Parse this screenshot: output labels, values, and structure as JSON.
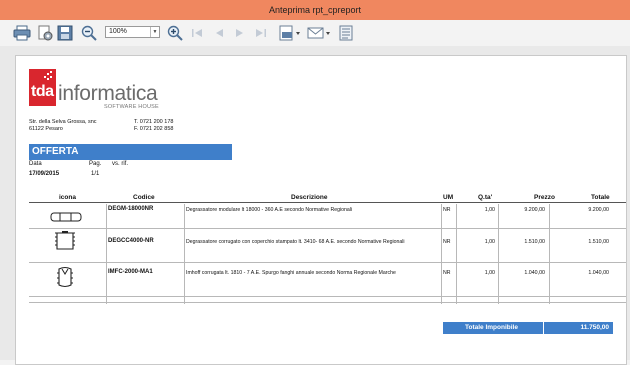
{
  "window": {
    "title": "Anteprima rpt_cpreport"
  },
  "toolbar": {
    "zoom": "100%",
    "icons": [
      "print-icon",
      "page-setup-icon",
      "save-icon",
      "zoom-out-icon",
      "zoom-in-icon",
      "first-page-icon",
      "previous-page-icon",
      "next-page-icon",
      "last-page-icon",
      "export-icon",
      "email-icon",
      "document-icon"
    ]
  },
  "company": {
    "logo_mark": "tda",
    "logo_name": "informatica",
    "logo_tagline": "SOFTWARE HOUSE",
    "address_line1": "Str. della Selva Grossa, snc",
    "address_line2": "61122 Pesaro",
    "phone": "T. 0721 200 178",
    "fax": "F. 0721 202 858"
  },
  "document": {
    "type": "OFFERTA",
    "date_label": "Data",
    "date": "17/09/2015",
    "page_label": "Pag.",
    "page": "1/1",
    "ref_label": "vs. rif."
  },
  "table": {
    "headers": {
      "icon": "icona",
      "code": "Codice",
      "description": "Descrizione",
      "um": "UM",
      "qty": "Q.ta'",
      "price": "Prezzo",
      "total": "Totale"
    },
    "rows": [
      {
        "code": "DEGM-18000NR",
        "description": "Degrassatore modulare lt 18000 - 360 A.E secondo Normative Regionali",
        "um": "NR",
        "qty": "1,00",
        "price": "9.200,00",
        "total": "9.200,00"
      },
      {
        "code": "DEGCC4000-NR",
        "description": "Degrassatore corrugato con coperchio stampato lt. 3410- 68 A.E. secondo Normative Regionali",
        "um": "NR",
        "qty": "1,00",
        "price": "1.510,00",
        "total": "1.510,00"
      },
      {
        "code": "IMFC-2000-MA1",
        "description": "Imhoff corrugata lt. 1810 - 7 A.E. Spurgo fanghi annuale secondo Norma Regionale Marche",
        "um": "NR",
        "qty": "1,00",
        "price": "1.040,00",
        "total": "1.040,00"
      }
    ]
  },
  "totals": {
    "label": "Totale Imponibile",
    "value": "11.750,00"
  },
  "colors": {
    "titlebar": "#f0875f",
    "accent_blue": "#3f7fca",
    "logo_red": "#d9262e"
  }
}
